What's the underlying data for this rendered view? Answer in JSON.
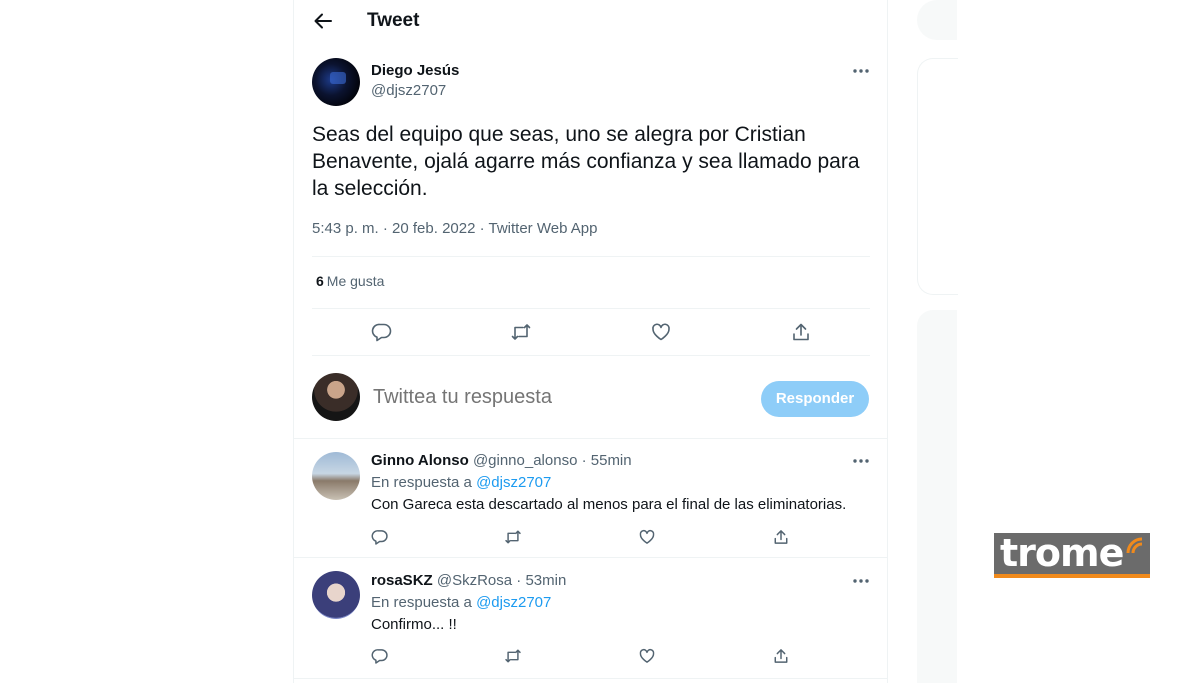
{
  "header": {
    "title": "Tweet"
  },
  "tweet": {
    "author_name": "Diego Jesús",
    "author_handle": "@djsz2707",
    "text": "Seas del equipo que seas, uno se alegra por Cristian Benavente, ojalá agarre más confianza y sea llamado para la selección.",
    "meta": "5:43 p. m. · 20 feb. 2022 · Twitter Web App",
    "likes_count": "6",
    "likes_label": "Me gusta"
  },
  "compose": {
    "placeholder": "Twittea tu respuesta",
    "button": "Responder"
  },
  "replies": [
    {
      "name": "Ginno Alonso",
      "handle": "@ginno_alonso",
      "time": "· 55min",
      "reply_prefix": "En respuesta a",
      "reply_to": "@djsz2707",
      "text": "Con Gareca esta descartado al menos para el final de las eliminatorias."
    },
    {
      "name": "rosaSKZ",
      "handle": "@SkzRosa",
      "time": "· 53min",
      "reply_prefix": "En respuesta a",
      "reply_to": "@djsz2707",
      "text": "Confirmo... !!"
    }
  ],
  "watermark": {
    "text": "trome"
  },
  "colors": {
    "accent": "#1d9bf0",
    "button_disabled": "#8ecdf8",
    "muted": "#536471",
    "logo_bg": "#6b6b6b",
    "logo_accent": "#f08a1c"
  },
  "icons": [
    "arrow-left-icon",
    "more-dots-icon",
    "reply-icon",
    "retweet-icon",
    "like-icon",
    "share-icon"
  ]
}
